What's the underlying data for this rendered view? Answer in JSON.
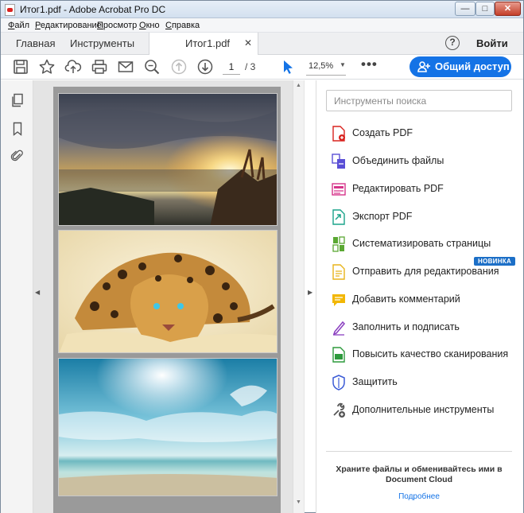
{
  "window": {
    "title": "Итог1.pdf - Adobe Acrobat Pro DC",
    "controls": {
      "minimize": "—",
      "maximize": "□",
      "close": "✕"
    }
  },
  "menubar": {
    "items": [
      {
        "label": "Файл",
        "accel": "Ф",
        "rest": "айл"
      },
      {
        "label": "Редактирование",
        "accel": "Р",
        "rest": "едактирование"
      },
      {
        "label": "Просмотр",
        "accel": "П",
        "rest": "росмотр"
      },
      {
        "label": "Окно",
        "accel": "О",
        "rest": "кно"
      },
      {
        "label": "Справка",
        "accel": "С",
        "rest": "правка"
      }
    ]
  },
  "tabs": {
    "home": "Главная",
    "tools": "Инструменты",
    "document": "Итог1.pdf",
    "close": "✕",
    "help": "?",
    "login": "Войти"
  },
  "toolbar": {
    "current_page": "1",
    "total_pages": "/ 3",
    "zoom": "12,5%",
    "zoom_caret": "▼",
    "more": "•••",
    "share_label": "Общий доступ",
    "icons": [
      "save-icon",
      "star-icon",
      "upload-cloud-icon",
      "print-icon",
      "mail-icon",
      "zoom-search-icon",
      "page-up-icon",
      "page-down-icon",
      "select-cursor-icon"
    ]
  },
  "leftrail": {
    "icons": [
      "pages-icon",
      "bookmark-icon",
      "attachment-icon"
    ]
  },
  "docview": {
    "collapse_left": "◀",
    "collapse_right": "▶",
    "scroll_up": "▲",
    "scroll_down": "▼",
    "pages": [
      "sunset-lake-image",
      "leopard-image",
      "sunny-sea-image"
    ]
  },
  "tools_pane": {
    "search_placeholder": "Инструменты поиска",
    "items": [
      {
        "label": "Создать PDF",
        "icon": "create-pdf-icon",
        "color": "#d9231f"
      },
      {
        "label": "Объединить файлы",
        "icon": "combine-files-icon",
        "color": "#5a4fd6"
      },
      {
        "label": "Редактировать PDF",
        "icon": "edit-pdf-icon",
        "color": "#d6338a"
      },
      {
        "label": "Экспорт PDF",
        "icon": "export-pdf-icon",
        "color": "#1aa38a"
      },
      {
        "label": "Систематизировать страницы",
        "icon": "organize-pages-icon",
        "color": "#5aa832"
      },
      {
        "label": "Отправить для редактирования",
        "icon": "send-for-review-icon",
        "color": "#e8b41b"
      },
      {
        "label": "Добавить комментарий",
        "icon": "comment-icon",
        "color": "#f2b705"
      },
      {
        "label": "Заполнить и подписать",
        "icon": "fill-sign-icon",
        "color": "#8a3fc0"
      },
      {
        "label": "Повысить качество сканирования",
        "icon": "enhance-scan-icon",
        "color": "#2d9a3c"
      },
      {
        "label": "Защитить",
        "icon": "protect-icon",
        "color": "#3b5bd6"
      },
      {
        "label": "Дополнительные инструменты",
        "icon": "more-tools-icon",
        "color": "#555555"
      }
    ],
    "new_badge": "НОВИНКА",
    "promo_text": "Храните файлы и обменивайтесь ими в Document Cloud",
    "promo_link": "Подробнее"
  },
  "colors": {
    "accent": "#1473e6"
  }
}
